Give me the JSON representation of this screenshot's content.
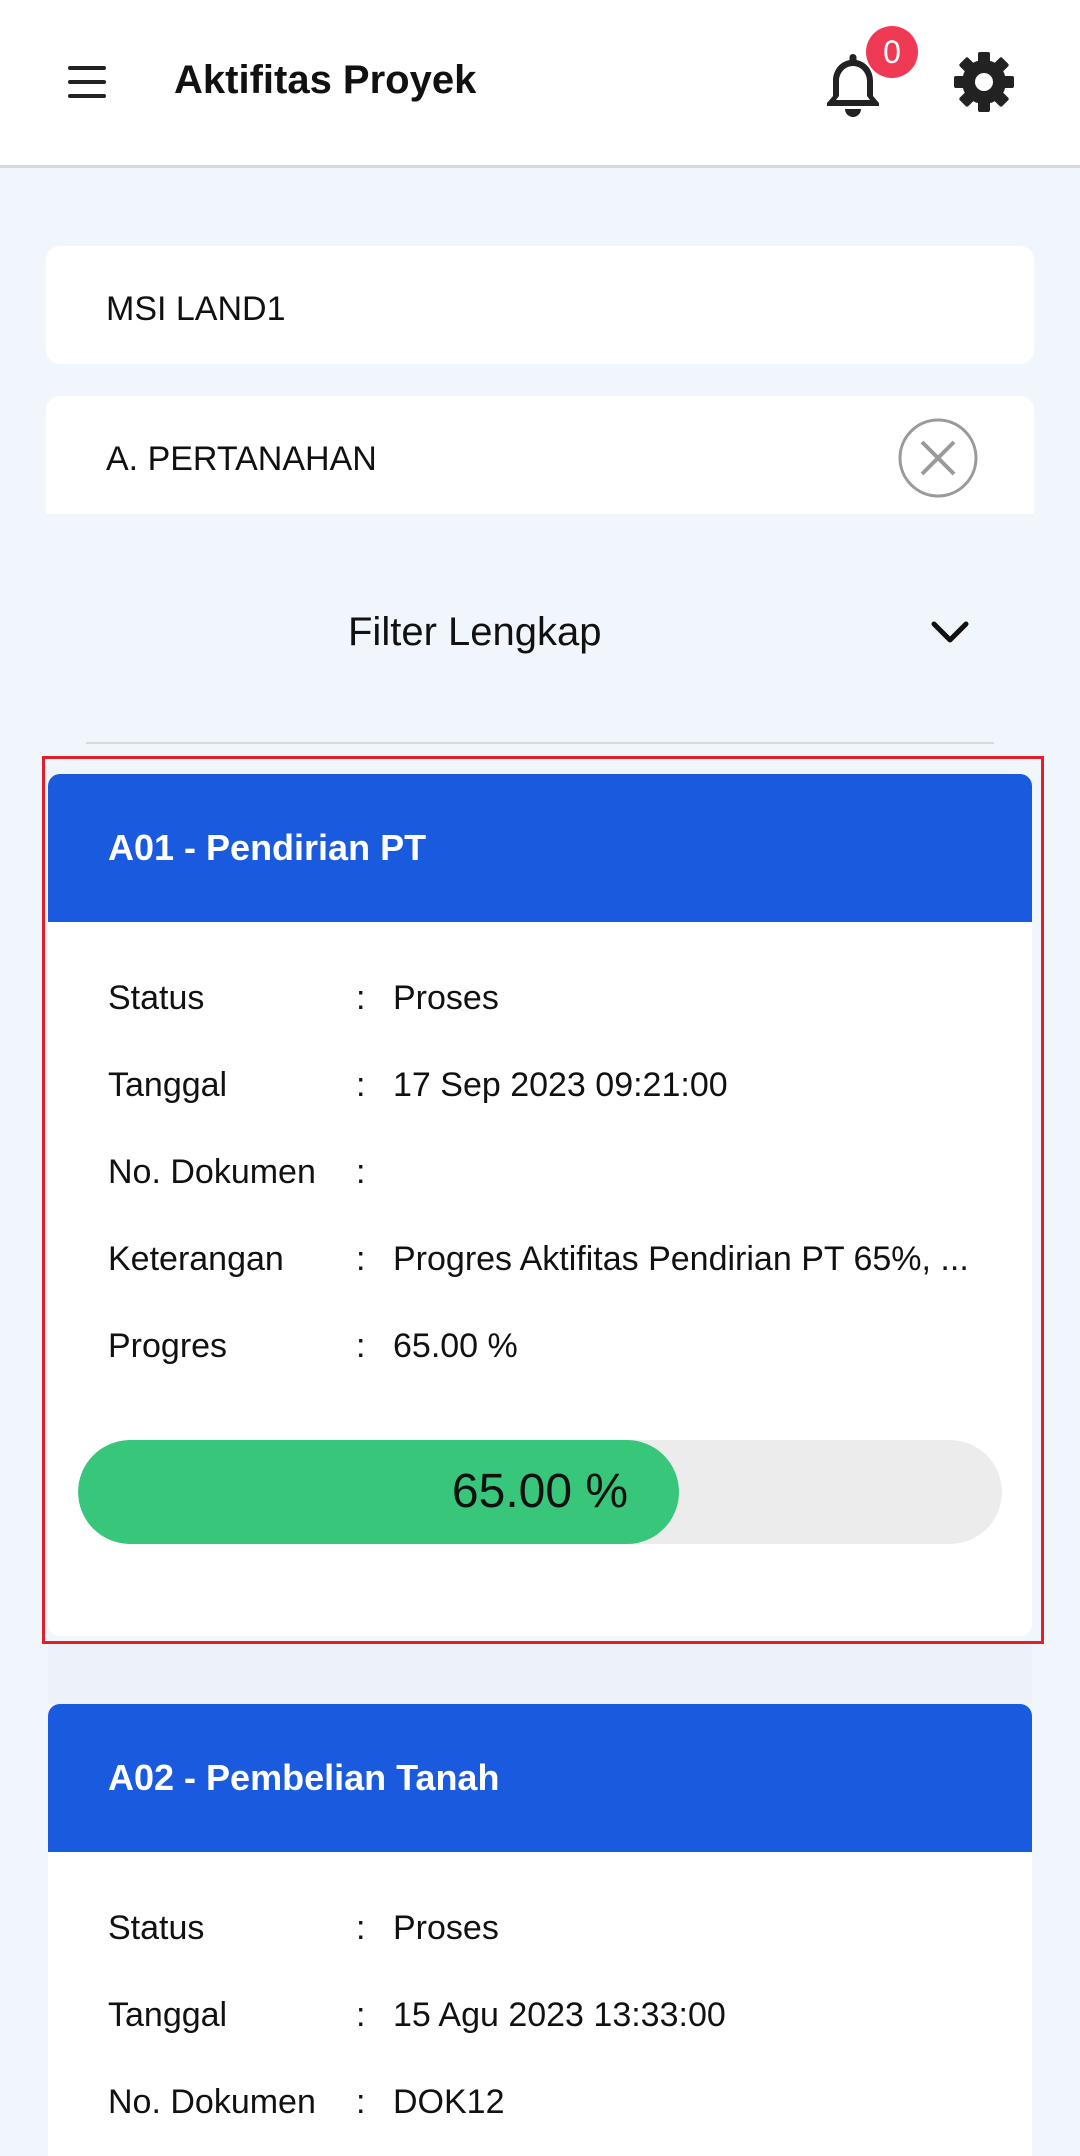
{
  "header": {
    "title": "Aktifitas Proyek",
    "notification_count": "0"
  },
  "filters": {
    "project": "MSI LAND1",
    "category": "A. PERTANAHAN",
    "toggle_label": "Filter Lengkap"
  },
  "labels": {
    "status": "Status",
    "tanggal": "Tanggal",
    "no_dokumen": "No. Dokumen",
    "keterangan": "Keterangan",
    "progres": "Progres",
    "colon": ":"
  },
  "cards": [
    {
      "title": "A01 - Pendirian PT",
      "status": "Proses",
      "tanggal": "17 Sep 2023 09:21:00",
      "no_dokumen": "",
      "keterangan": "Progres Aktifitas Pendirian PT 65%, ...",
      "progres": "65.00 %",
      "progress_fraction": 0.65
    },
    {
      "title": "A02 - Pembelian Tanah",
      "status": "Proses",
      "tanggal": "15 Agu 2023 13:33:00",
      "no_dokumen": "DOK12"
    }
  ],
  "icons": {
    "menu": "menu-icon",
    "bell": "bell-icon",
    "gear": "gear-icon",
    "clear": "clear-circle-icon",
    "chevron": "chevron-down-icon"
  },
  "colors": {
    "card_header": "#1a5ade",
    "progress_fill": "#37c67a",
    "badge": "#f03a55",
    "highlight": "#e01f2b"
  }
}
